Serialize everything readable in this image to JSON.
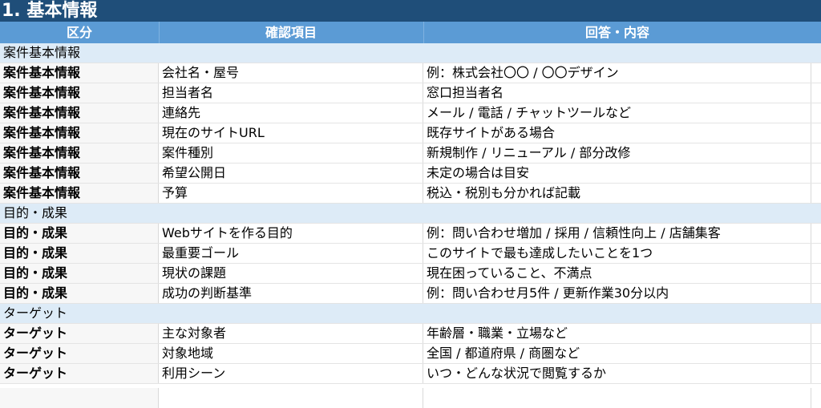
{
  "sheet": {
    "title": "1. 基本情報",
    "headers": {
      "category": "区分",
      "item": "確認項目",
      "answer": "回答・内容"
    }
  },
  "rows": [
    {
      "type": "section",
      "label": "案件基本情報"
    },
    {
      "type": "data",
      "category": "案件基本情報",
      "item": "会社名・屋号",
      "answer": "例：株式会社〇〇 / 〇〇デザイン"
    },
    {
      "type": "data",
      "category": "案件基本情報",
      "item": "担当者名",
      "answer": "窓口担当者名"
    },
    {
      "type": "data",
      "category": "案件基本情報",
      "item": "連絡先",
      "answer": "メール / 電話 / チャットツールなど"
    },
    {
      "type": "data",
      "category": "案件基本情報",
      "item": "現在のサイトURL",
      "answer": "既存サイトがある場合"
    },
    {
      "type": "data",
      "category": "案件基本情報",
      "item": "案件種別",
      "answer": "新規制作 / リニューアル / 部分改修"
    },
    {
      "type": "data",
      "category": "案件基本情報",
      "item": "希望公開日",
      "answer": "未定の場合は目安"
    },
    {
      "type": "data",
      "category": "案件基本情報",
      "item": "予算",
      "answer": "税込・税別も分かれば記載"
    },
    {
      "type": "section",
      "label": "目的・成果"
    },
    {
      "type": "data",
      "category": "目的・成果",
      "item": "Webサイトを作る目的",
      "answer": "例：問い合わせ増加 / 採用 / 信頼性向上 / 店舗集客"
    },
    {
      "type": "data",
      "category": "目的・成果",
      "item": "最重要ゴール",
      "answer": "このサイトで最も達成したいことを1つ"
    },
    {
      "type": "data",
      "category": "目的・成果",
      "item": "現状の課題",
      "answer": "現在困っていること、不満点"
    },
    {
      "type": "data",
      "category": "目的・成果",
      "item": "成功の判断基準",
      "answer": "例：問い合わせ月5件 / 更新作業30分以内"
    },
    {
      "type": "section",
      "label": "ターゲット"
    },
    {
      "type": "data",
      "category": "ターゲット",
      "item": "主な対象者",
      "answer": "年齢層・職業・立場など"
    },
    {
      "type": "data",
      "category": "ターゲット",
      "item": "対象地域",
      "answer": "全国 / 都道府県 / 商圏など"
    },
    {
      "type": "data",
      "category": "ターゲット",
      "item": "利用シーン",
      "answer": "いつ・どんな状況で閲覧するか"
    }
  ]
}
